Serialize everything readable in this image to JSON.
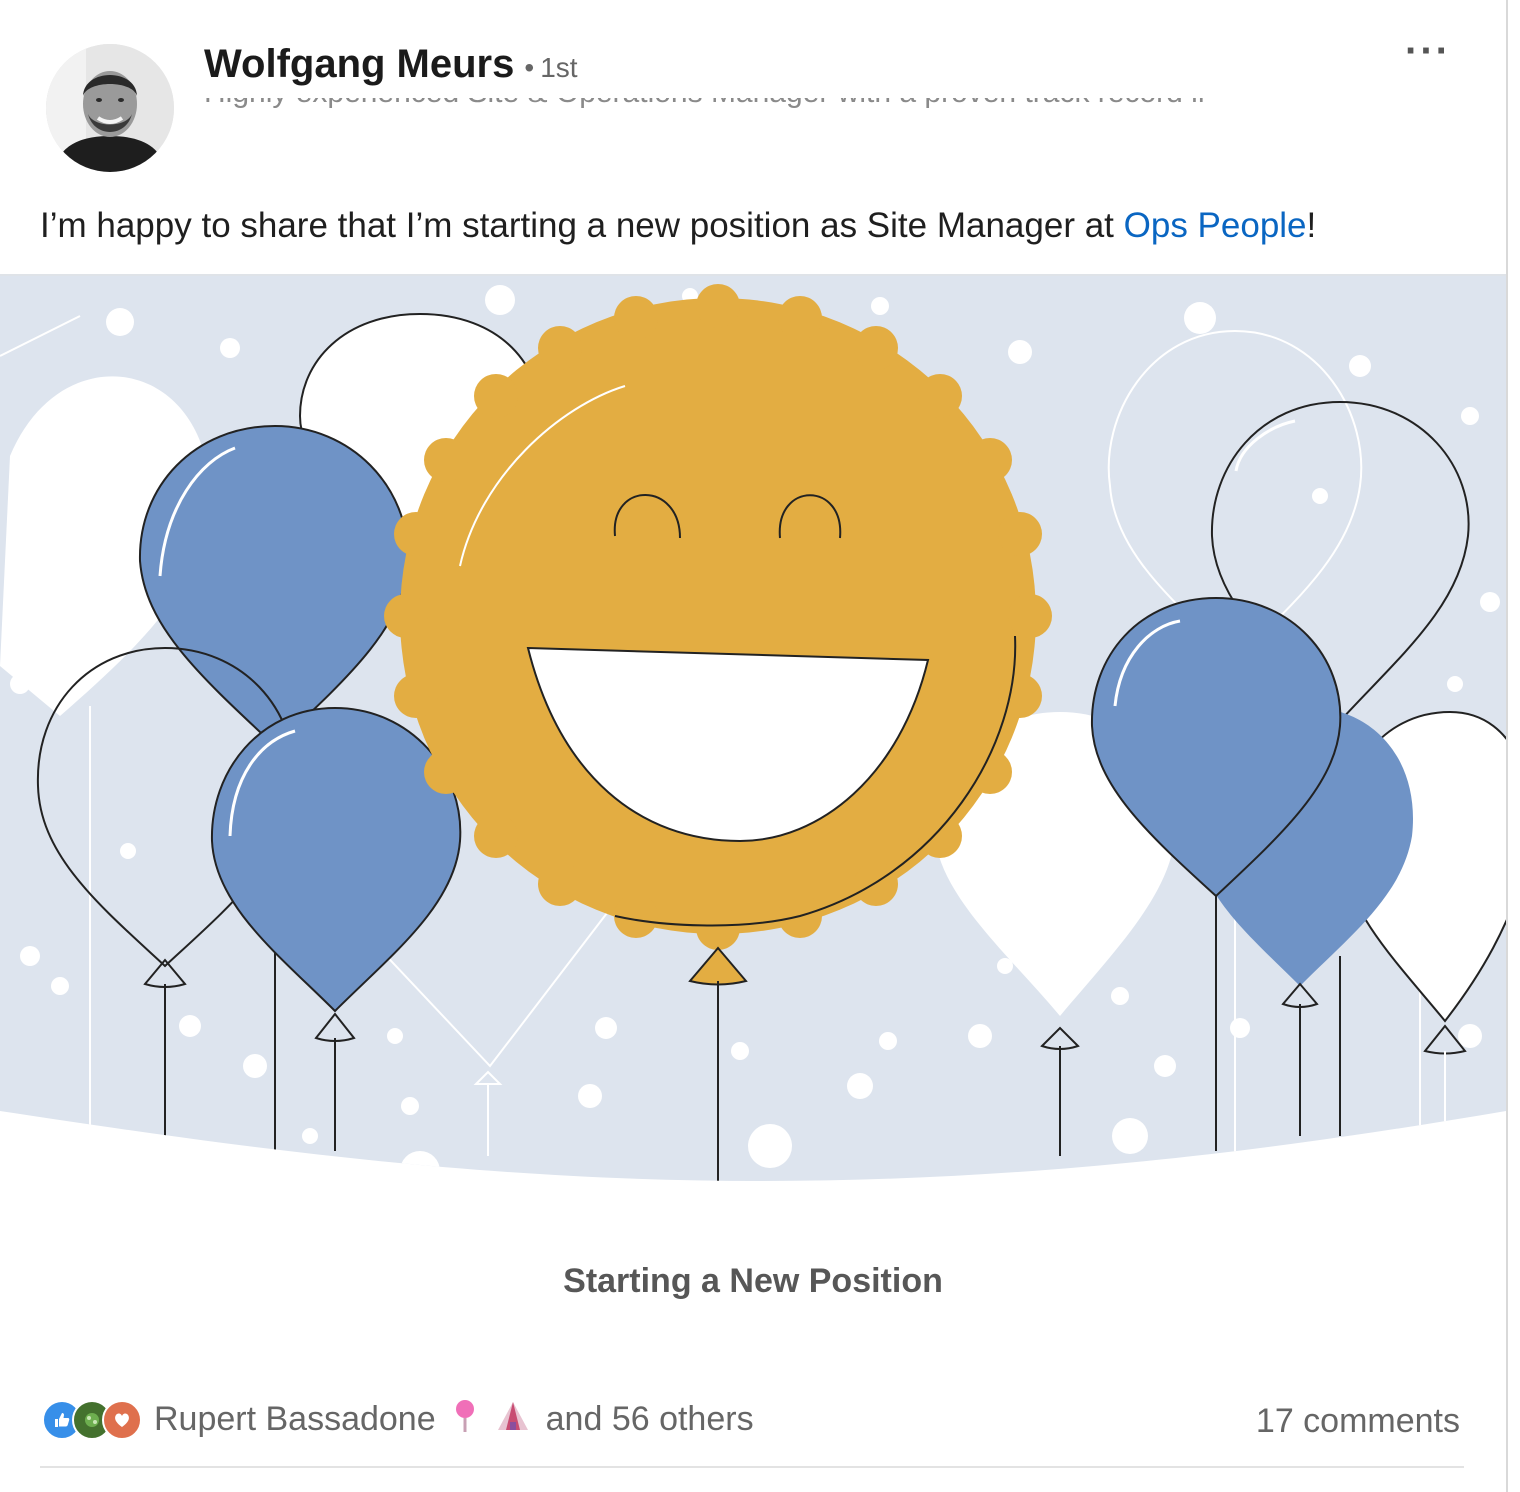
{
  "post": {
    "author_name": "Wolfgang Meurs",
    "separator": "•",
    "connection_degree": "1st",
    "headline_partial": "Highly experienced Site & Operations Manager with a proven track record in Operations",
    "more_label": "···",
    "text_before": "I’m happy to share that I’m starting a new position as Site Manager at ",
    "mention": "Ops People",
    "text_after": "!",
    "image_caption": "Starting a New Position"
  },
  "social": {
    "first_reactor": "Rupert Bassadone",
    "others_text": "and 56 others",
    "comments": "17 comments",
    "reaction_icons": [
      "like-icon",
      "celebrate-icon",
      "love-icon"
    ],
    "colors": {
      "like": "#378fe9",
      "celebrate": "#44712e",
      "love": "#df704d"
    }
  },
  "colors": {
    "link": "#0a66c2",
    "balloon_blue": "#6f93c6",
    "sun_gold": "#e3ad42",
    "sky": "#dde4ee"
  }
}
